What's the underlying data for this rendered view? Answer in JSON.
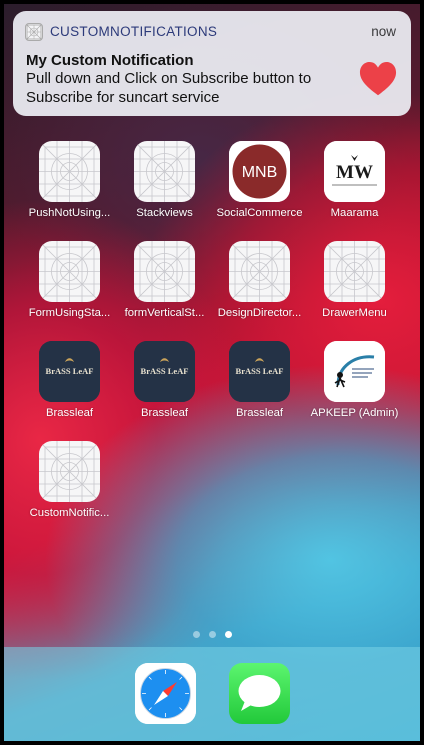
{
  "notification": {
    "app_name": "CUSTOMNOTIFICATIONS",
    "time": "now",
    "title": "My Custom Notification",
    "body": "Pull down and Click on Subscribe button to Subscribe for suncart service",
    "heart_color": "#ec4148"
  },
  "apps": [
    {
      "label": "PushNotUsing...",
      "icon": "placeholder-icon"
    },
    {
      "label": "Stackviews",
      "icon": "placeholder-icon"
    },
    {
      "label": "SocialCommerce",
      "icon": "mnb-logo-icon",
      "logo_text": "MNB"
    },
    {
      "label": "Maarama",
      "icon": "maarama-logo-icon",
      "logo_text": "MW"
    },
    {
      "label": "FormUsingSta...",
      "icon": "placeholder-icon"
    },
    {
      "label": "formVerticalSt...",
      "icon": "placeholder-icon"
    },
    {
      "label": "DesignDirector...",
      "icon": "placeholder-icon"
    },
    {
      "label": "DrawerMenu",
      "icon": "placeholder-icon"
    },
    {
      "label": "Brassleaf",
      "icon": "brassleaf-logo-icon",
      "logo_text": "BrASS LeAF"
    },
    {
      "label": "Brassleaf",
      "icon": "brassleaf-logo-icon",
      "logo_text": "BrASS LeAF"
    },
    {
      "label": "Brassleaf",
      "icon": "brassleaf-logo-icon",
      "logo_text": "BrASS LeAF"
    },
    {
      "label": "APKEEP (Admin)",
      "icon": "apkeep-logo-icon"
    },
    {
      "label": "CustomNotific...",
      "icon": "placeholder-icon"
    }
  ],
  "page_dots": {
    "count": 3,
    "active_index": 2
  },
  "dock": [
    {
      "icon": "safari-icon"
    },
    {
      "icon": "messages-icon"
    }
  ]
}
